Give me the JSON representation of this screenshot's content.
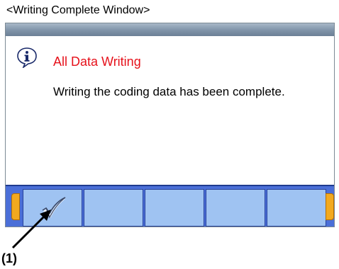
{
  "caption": "<Writing Complete Window>",
  "dialog": {
    "title": "All Data Writing",
    "message": "Writing the coding data has been complete."
  },
  "toolbar": {
    "buttons": [
      {
        "icon": "checkmark-icon"
      },
      {
        "icon": ""
      },
      {
        "icon": ""
      },
      {
        "icon": ""
      },
      {
        "icon": ""
      }
    ]
  },
  "callout": "(1)",
  "colors": {
    "title_red": "#e6111b",
    "toolbar_blue": "#4b6fd8",
    "button_blue": "#9fc3f2",
    "end_cap_orange": "#f2a91f"
  }
}
